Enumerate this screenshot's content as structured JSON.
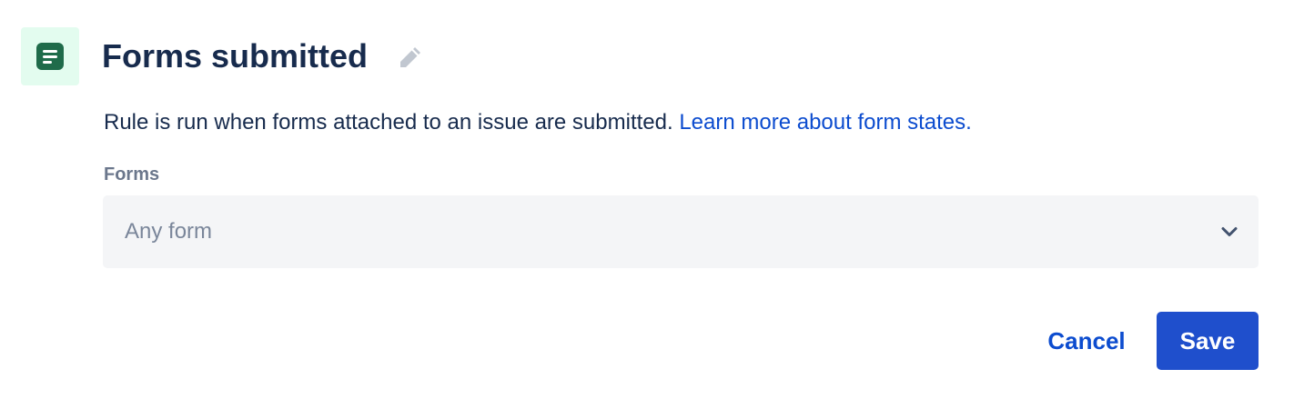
{
  "header": {
    "icon": "form-icon",
    "title": "Forms submitted",
    "edit_icon": "pencil-icon"
  },
  "description": {
    "text": "Rule is run when forms attached to an issue are submitted.",
    "link_text": "Learn more about form states."
  },
  "forms_field": {
    "label": "Forms",
    "selected_value": "Any form",
    "dropdown_icon": "chevron-down-icon"
  },
  "actions": {
    "cancel_label": "Cancel",
    "save_label": "Save"
  },
  "colors": {
    "icon_tile_background": "#e3fcef",
    "icon_foreground": "#1f6b4a",
    "title_text": "#172b4d",
    "link": "#0c4ccf",
    "label_text": "#6b778c",
    "select_background": "#f4f5f7",
    "placeholder_text": "#7a869a",
    "primary_button": "#1f4fcc"
  }
}
